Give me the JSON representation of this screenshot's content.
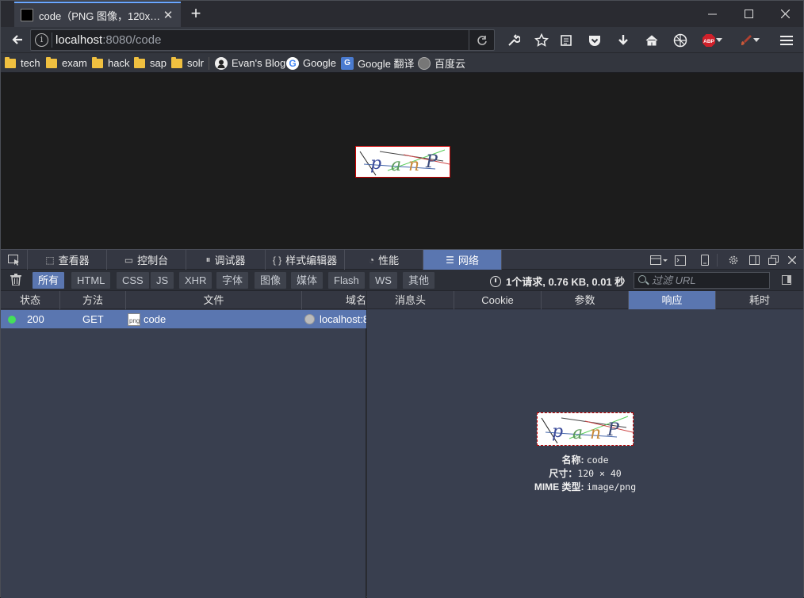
{
  "window": {
    "tab_title": "code（PNG 图像，120x…",
    "close_tab": "✕",
    "new_tab": "+",
    "minimize": "─",
    "maximize": "☐",
    "close": "✕"
  },
  "navbar": {
    "url_host": "localhost",
    "url_rest": ":8080/code"
  },
  "bookmarks": [
    {
      "label": "tech",
      "icon": "folder-icon"
    },
    {
      "label": "exam",
      "icon": "folder-icon"
    },
    {
      "label": "hack",
      "icon": "folder-icon"
    },
    {
      "label": "sap",
      "icon": "folder-icon"
    },
    {
      "label": "solr",
      "icon": "folder-icon"
    },
    {
      "label": "Evan's Blog",
      "icon": "github-icon"
    },
    {
      "label": "Google",
      "icon": "google-icon"
    },
    {
      "label": "Google 翻译",
      "icon": "google-translate-icon"
    },
    {
      "label": "百度云",
      "icon": "globe-icon"
    }
  ],
  "captcha": {
    "text": "panP"
  },
  "devtools": {
    "tabs": [
      {
        "label": "查看器",
        "icon": "inspector-icon"
      },
      {
        "label": "控制台",
        "icon": "console-icon"
      },
      {
        "label": "调试器",
        "icon": "debugger-icon"
      },
      {
        "label": "样式编辑器",
        "icon": "style-editor-icon"
      },
      {
        "label": "性能",
        "icon": "performance-icon"
      },
      {
        "label": "网络",
        "icon": "network-icon",
        "active": true
      }
    ],
    "filters": [
      "所有",
      "HTML",
      "CSS",
      "JS",
      "XHR",
      "字体",
      "图像",
      "媒体",
      "Flash",
      "WS",
      "其他"
    ],
    "active_filter": "所有",
    "summary": "1个请求, 0.76 KB, 0.01 秒",
    "filter_placeholder": "过滤 URL",
    "columns": [
      "状态",
      "方法",
      "文件",
      "域名"
    ],
    "requests": [
      {
        "status": "200",
        "method": "GET",
        "file": "code",
        "domain": "localhost:8"
      }
    ],
    "detail_tabs": [
      "消息头",
      "Cookie",
      "参数",
      "响应",
      "耗时"
    ],
    "active_detail_tab": "响应",
    "image_meta": {
      "name_label": "名称:",
      "name_value": "code",
      "size_label": "尺寸：",
      "size_value": "120 × 40",
      "mime_label": "MIME 类型:",
      "mime_value": "image/png"
    }
  },
  "colors": {
    "accent": "#5a76b0",
    "status_ok": "#44e05a",
    "page_bg": "#1c1c1c"
  }
}
